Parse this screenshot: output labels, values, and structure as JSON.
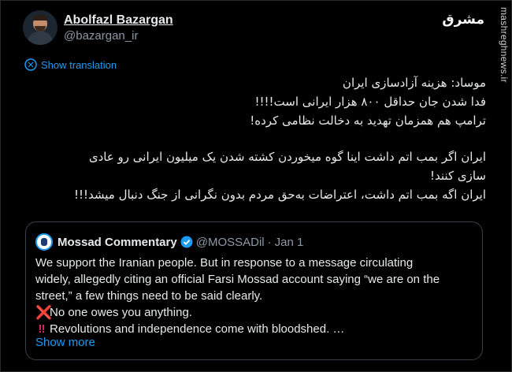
{
  "author": {
    "display_name": "Abolfazl Bazargan",
    "handle": "@bazargan_ir"
  },
  "brand_logo_text": "مشرق",
  "watermark": "mashreghnews.ir",
  "translate_label": "Show translation",
  "tweet_lines_part1": [
    "موساد: هزینه آزادسازی ایران",
    "فدا شدن جان حداقل ۸۰۰ هزار ایرانی است!!!!",
    "ترامپ هم همزمان تهدید به دخالت نظامی کرده!"
  ],
  "tweet_lines_part2": [
    "ایران اگر بمب اتم داشت اینا گوه میخوردن کشته شدن یک میلیون ایرانی رو عادی",
    "سازی کنند!",
    "ایران اگه بمب اتم داشت، اعتراضات به‌حق مردم بدون نگرانی از جنگ دنبال میشد!!!"
  ],
  "quote": {
    "name": "Mossad Commentary",
    "handle": "@MOSSADil",
    "separator": "·",
    "date": "Jan 1",
    "lines": [
      "We support the Iranian people. But in response to a message circulating",
      "widely, allegedly citing an official Farsi Mossad account saying “we are on the",
      "street,” a few things need to be said clearly."
    ],
    "cross_mark": "❌",
    "bang_mark": "‼",
    "point1": "No one owes you anything.",
    "point2": "Revolutions and independence come with bloodshed. …",
    "show_more": "Show more"
  },
  "colors": {
    "background": "#000000",
    "text": "#e7e9ea",
    "muted": "#8b98a5",
    "link": "#1d9bf0",
    "red_mark": "#e0245e"
  },
  "icons": [
    "translate-icon",
    "verified-badge-icon",
    "avatar",
    "quote-avatar"
  ]
}
